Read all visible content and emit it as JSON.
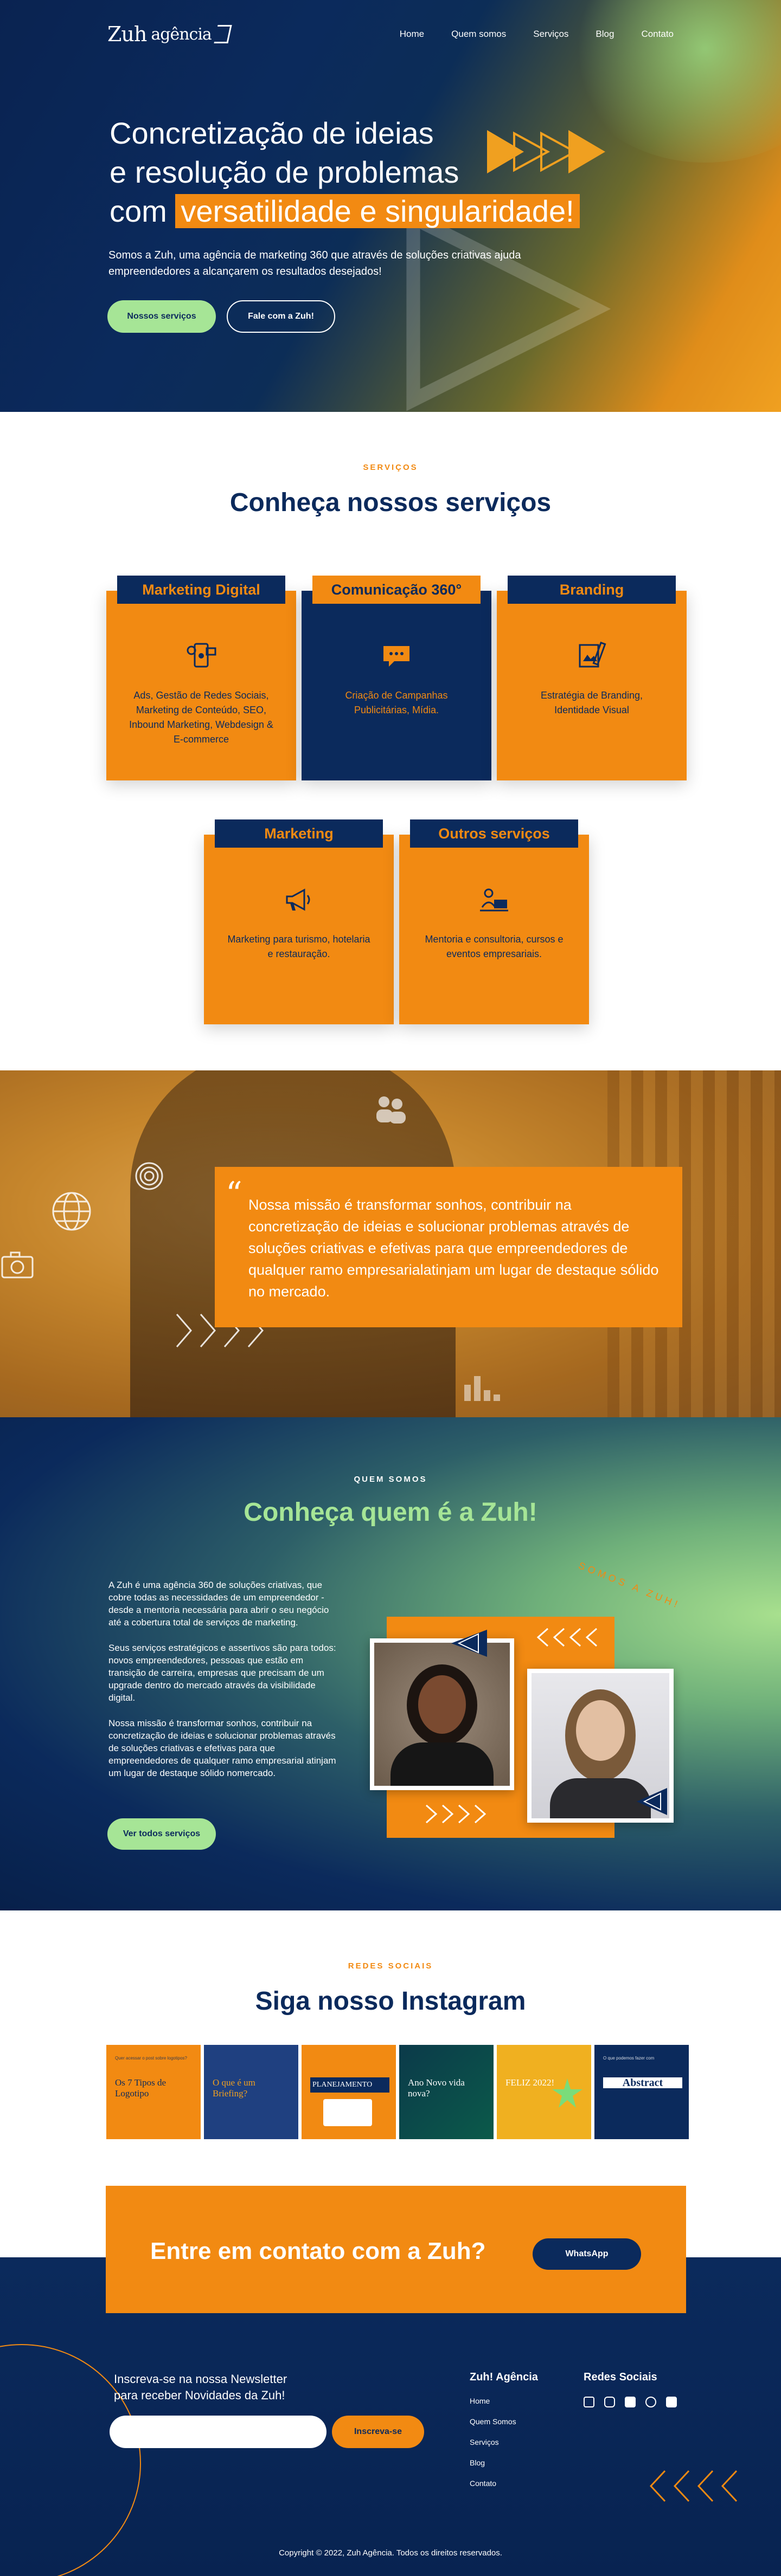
{
  "nav": {
    "logo": "Zuh",
    "logo_sub": "agência",
    "items": [
      "Home",
      "Quem somos",
      "Serviços",
      "Blog",
      "Contato"
    ]
  },
  "hero": {
    "title_line1": "Concretização de ideias",
    "title_line2": "e resolução de problemas",
    "title_line3_prefix": "com",
    "title_highlight": "versatilidade e singularidade!",
    "subtitle": "Somos a Zuh, uma agência de marketing 360 que através de soluções criativas ajuda empreendedores a alcançarem os resultados desejados!",
    "btn_primary": "Nossos serviços",
    "btn_secondary": "Fale com a Zuh!"
  },
  "services": {
    "eyebrow": "SERVIÇOS",
    "title": "Conheça nossos serviços",
    "cards": [
      {
        "title": "Marketing Digital",
        "text": "Ads, Gestão de Redes Sociais, Marketing de Conteúdo, SEO, Inbound Marketing, Webdesign & E-commerce",
        "icon": "social-media-icon"
      },
      {
        "title": "Comunicação 360°",
        "text": "Criação de Campanhas Publicitárias, Mídia.",
        "icon": "chat-bubble-icon"
      },
      {
        "title": "Branding",
        "text": "Estratégia de Branding, Identidade Visual",
        "icon": "brand-design-icon"
      },
      {
        "title": "Marketing",
        "text": "Marketing para turismo, hotelaria e restauração.",
        "icon": "megaphone-icon"
      },
      {
        "title": "Outros serviços",
        "text": "Mentoria e consultoria, cursos e eventos empresariais.",
        "icon": "consulting-icon"
      }
    ]
  },
  "mission": {
    "quote_mark": "“",
    "text": "Nossa missão é transformar sonhos, contribuir na concretização de ideias e solucionar problemas através de soluções criativas e efetivas para que empreendedores de qualquer ramo empresarialatinjam um lugar de destaque sólido no mercado."
  },
  "about": {
    "eyebrow": "QUEM SOMOS",
    "title": "Conheça quem é a Zuh!",
    "paragraphs": [
      "A Zuh é uma agência 360 de soluções criativas, que cobre todas as necessidades de um empreendedor - desde a mentoria necessária para abrir o seu negócio até a cobertura total de serviços de marketing.",
      "Seus serviços estratégicos e assertivos são para todos: novos empreendedores, pessoas que estão em transição de carreira, empresas que precisam de um upgrade dentro do mercado através da visibilidade digital.",
      "Nossa missão é transformar sonhos, contribuir na concretização de ideias e solucionar problemas através de soluções criativas e efetivas para que empreendedores de qualquer ramo empresarial atinjam um lugar de destaque sólido nomercado."
    ],
    "button": "Ver todos serviços",
    "badge": "SOMOS A ZUH!"
  },
  "instagram": {
    "eyebrow": "REDES SOCIAIS",
    "title": "Siga nosso Instagram",
    "posts": [
      {
        "small": "Quer acessar o post sobre logotipos?",
        "title": "Os 7 Tipos de Logotipo",
        "bg": "#f28a12",
        "fg": "#0b2a5c"
      },
      {
        "small": "",
        "title": "O que é um Briefing?",
        "bg": "#1f4080",
        "fg": "#f0a020"
      },
      {
        "small": "",
        "title": "PLANEJAMENTO",
        "bg": "#f28a12",
        "fg": "#fff"
      },
      {
        "small": "",
        "title": "Ano Novo vida nova?",
        "bg": "#0b3a4a",
        "fg": "#ffffff"
      },
      {
        "small": "",
        "title": "FELIZ 2022!",
        "bg": "#f0b020",
        "fg": "#ffffff"
      },
      {
        "small": "O que podemos fazer com",
        "title": "Abstract",
        "bg": "#0b2a5c",
        "fg": "#ffffff"
      }
    ]
  },
  "cta": {
    "title": "Entre em contato com a Zuh?",
    "button": "WhatsApp"
  },
  "footer": {
    "newsletter_line1": "Inscreva-se na nossa Newsletter",
    "newsletter_line2": "para receber Novidades da Zuh!",
    "newsletter_placeholder": "",
    "newsletter_button": "Inscreva-se",
    "col1_title": "Zuh! Agência",
    "col1_links": [
      "Home",
      "Quem Somos",
      "Serviços",
      "Blog",
      "Contato"
    ],
    "col2_title": "Redes Sociais",
    "social_icons": [
      "linkedin-icon",
      "instagram-icon",
      "facebook-icon",
      "pinterest-icon",
      "email-icon"
    ],
    "copyright": "Copyright © 2022, Zuh Agência. Todos os direitos reservados."
  },
  "colors": {
    "navy": "#0b2a5c",
    "orange": "#f28a12",
    "green": "#a6e596"
  }
}
